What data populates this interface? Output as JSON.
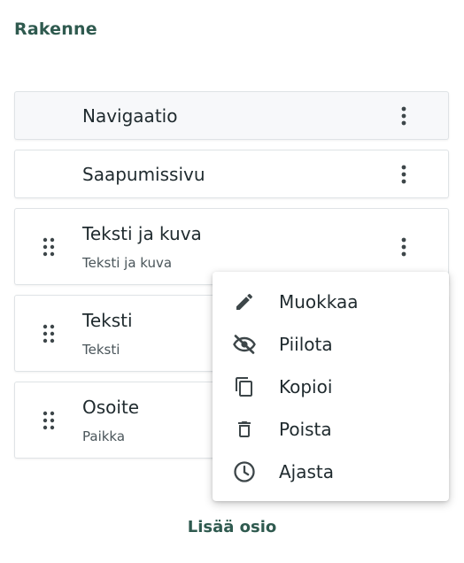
{
  "panel": {
    "title": "Rakenne"
  },
  "sections": [
    {
      "name": "Navigaatio",
      "subtitle": "",
      "draggable": false
    },
    {
      "name": "Saapumissivu",
      "subtitle": "",
      "draggable": false
    },
    {
      "name": "Teksti ja kuva",
      "subtitle": "Teksti ja kuva",
      "draggable": true
    },
    {
      "name": "Teksti",
      "subtitle": "Teksti",
      "draggable": true
    },
    {
      "name": "Osoite",
      "subtitle": "Paikka",
      "draggable": true
    }
  ],
  "context_menu": {
    "items": [
      {
        "label": "Muokkaa",
        "icon": "pencil-icon"
      },
      {
        "label": "Piilota",
        "icon": "eye-off-icon"
      },
      {
        "label": "Kopioi",
        "icon": "copy-icon"
      },
      {
        "label": "Poista",
        "icon": "trash-icon"
      },
      {
        "label": "Ajasta",
        "icon": "clock-icon"
      }
    ]
  },
  "footer": {
    "add_section_label": "Lisää osio"
  },
  "colors": {
    "accent": "#2f5a4f",
    "text": "#1f2a2e",
    "border": "#dfe3e6",
    "icon": "#3d4649"
  }
}
